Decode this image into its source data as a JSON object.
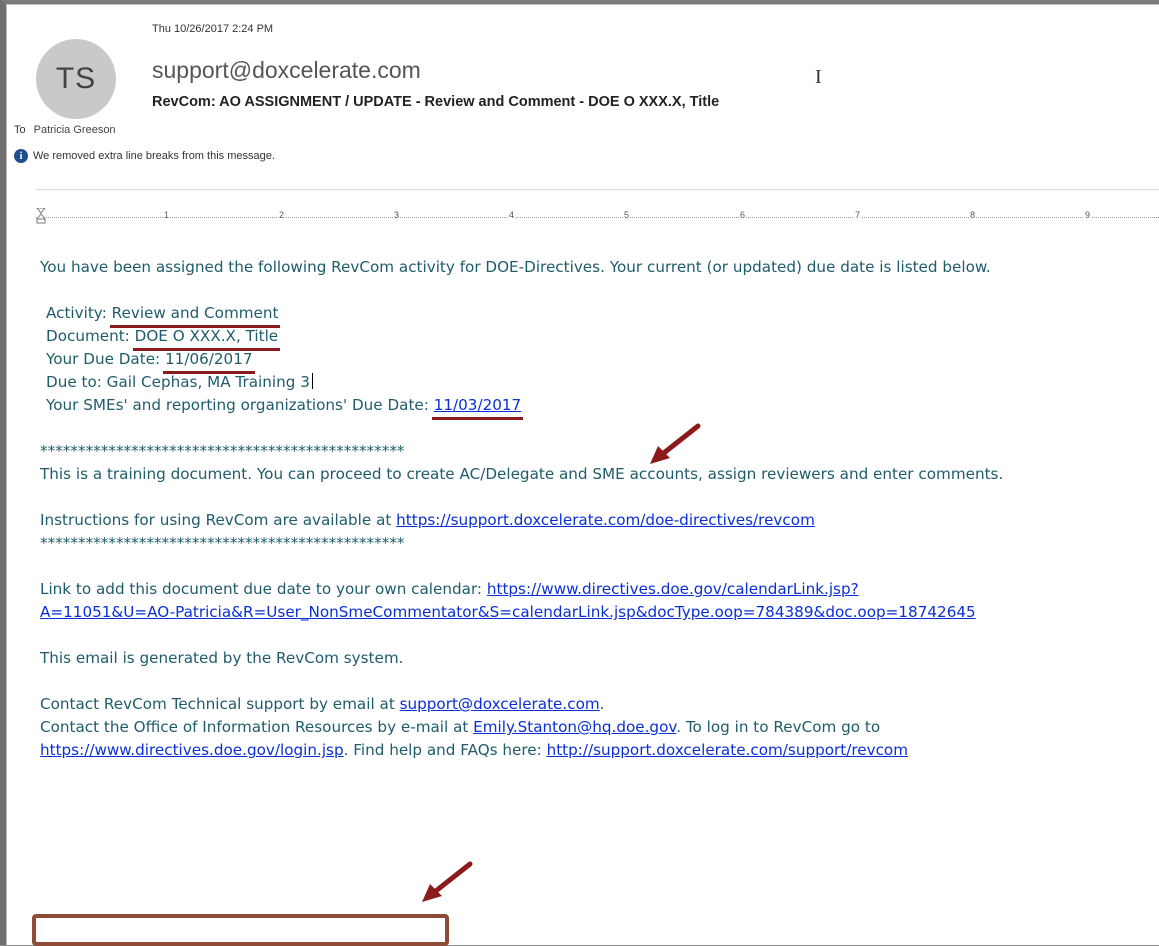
{
  "email": {
    "date": "Thu 10/26/2017 2:24 PM",
    "avatar_initials": "TS",
    "sender": "support@doxcelerate.com",
    "subject": "RevCom: AO ASSIGNMENT / UPDATE - Review and Comment - DOE O XXX.X, Title",
    "to_label": "To",
    "to_name": "Patricia Greeson",
    "info_message": "We removed extra line breaks from this message."
  },
  "ruler": {
    "numbers": [
      "1",
      "2",
      "3",
      "4",
      "5",
      "6",
      "7",
      "8",
      "9"
    ]
  },
  "message": {
    "intro": "You have been assigned the following RevCom activity for DOE-Directives. Your current (or updated) due date is listed below.",
    "activity_label": "Activity: ",
    "activity_value": "Review and Comment",
    "document_label": "Document: ",
    "document_value": "DOE O XXX.X, Title",
    "due_label": "Your Due Date: ",
    "due_value": "11/06/2017",
    "due_to": "Due to: Gail Cephas, MA Training 3",
    "sme_label": "Your SMEs' and reporting organizations' Due Date: ",
    "sme_value": "11/03/2017",
    "stars": "************************************************",
    "training": "This is a training document. You can proceed to create AC/Delegate and SME accounts, assign reviewers and enter comments.",
    "instructions_label": "Instructions for using RevCom are available at ",
    "instructions_link": "https://support.doxcelerate.com/doe-directives/revcom",
    "calendar_label": "Link to add this document due date to your own calendar: ",
    "calendar_link_1": "https://www.directives.doe.gov/calendarLink.jsp?",
    "calendar_link_2": "A=11051&U=AO-Patricia&R=User_NonSmeCommentator&S=calendarLink.jsp&docType.oop=784389&doc.oop=18742645",
    "generated": "This email is generated by the RevCom system.",
    "contact_tech_label": "Contact RevCom Technical support by email at ",
    "contact_tech_link": "support@doxcelerate.com",
    "contact_tech_end": ".",
    "contact_oir_label": "Contact the Office of Information Resources by e-mail at ",
    "contact_oir_link": "Emily.Stanton@hq.doe.gov",
    "contact_oir_end": ". To log in to RevCom go to",
    "login_link": "https://www.directives.doe.gov/login.jsp",
    "help_label": ". Find help and FAQs here: ",
    "help_link": "http://support.doxcelerate.com/support/revcom"
  },
  "colors": {
    "body_text": "#1f5c6b",
    "link": "#0b2fd6",
    "annotation": "#8b1a1a"
  }
}
